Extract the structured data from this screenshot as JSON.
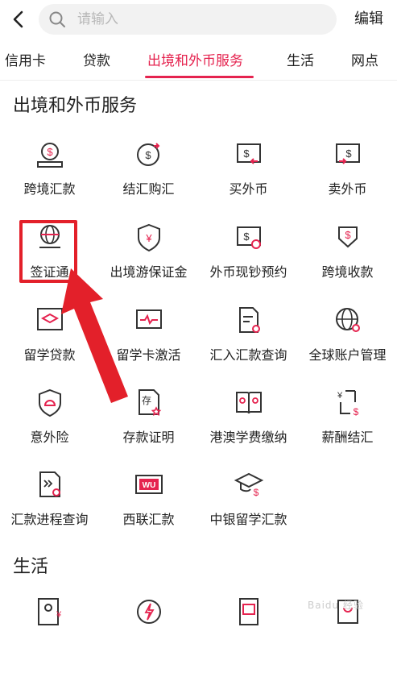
{
  "search": {
    "placeholder": "请输入"
  },
  "header": {
    "edit_label": "编辑"
  },
  "tabs": [
    "信用卡",
    "贷款",
    "出境和外币服务",
    "生活",
    "网点"
  ],
  "sections": {
    "overseas": {
      "title": "出境和外币服务",
      "items": [
        {
          "label": "跨境汇款",
          "icon": "cross-border-remittance-icon"
        },
        {
          "label": "结汇购汇",
          "icon": "currency-exchange-icon"
        },
        {
          "label": "买外币",
          "icon": "buy-foreign-currency-icon"
        },
        {
          "label": "卖外币",
          "icon": "sell-foreign-currency-icon"
        },
        {
          "label": "签证通",
          "icon": "visa-globe-icon"
        },
        {
          "label": "出境游保证金",
          "icon": "travel-deposit-shield-icon"
        },
        {
          "label": "外币现钞预约",
          "icon": "cash-reservation-icon"
        },
        {
          "label": "跨境收款",
          "icon": "cross-border-receipt-icon"
        },
        {
          "label": "留学贷款",
          "icon": "study-loan-icon"
        },
        {
          "label": "留学卡激活",
          "icon": "study-card-activation-icon"
        },
        {
          "label": "汇入汇款查询",
          "icon": "inward-remittance-query-icon"
        },
        {
          "label": "全球账户管理",
          "icon": "global-account-icon"
        },
        {
          "label": "意外险",
          "icon": "accident-insurance-icon"
        },
        {
          "label": "存款证明",
          "icon": "deposit-certificate-icon"
        },
        {
          "label": "港澳学费缴纳",
          "icon": "tuition-payment-icon"
        },
        {
          "label": "薪酬结汇",
          "icon": "salary-settlement-icon"
        },
        {
          "label": "汇款进程查询",
          "icon": "remittance-progress-icon"
        },
        {
          "label": "西联汇款",
          "icon": "western-union-icon"
        },
        {
          "label": "中银留学汇款",
          "icon": "study-abroad-remittance-icon"
        }
      ]
    },
    "life": {
      "title": "生活"
    }
  },
  "icon_text": {
    "wu": "WU",
    "deposit": "存"
  },
  "watermark": "Baidu 经验",
  "colors": {
    "accent": "#e5234f",
    "highlight": "#e3202a"
  }
}
